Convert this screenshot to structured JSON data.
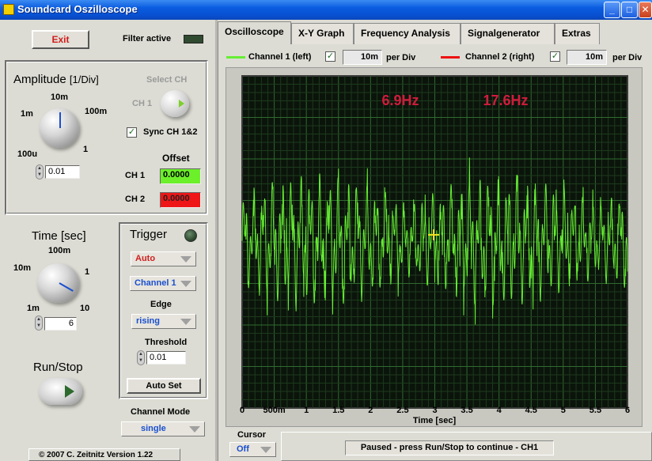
{
  "window": {
    "title": "Soundcard Oszilloscope",
    "minimize": "_",
    "maximize": "□",
    "close": "✕"
  },
  "left": {
    "exit_label": "Exit",
    "filter_label": "Filter active",
    "amplitude": {
      "title": "Amplitude",
      "unit": "[1/Div]",
      "scale": [
        "10m",
        "100m",
        "1m",
        "1",
        "100u"
      ],
      "value": "0.01"
    },
    "select_ch": {
      "title": "Select CH",
      "label": "CH 1"
    },
    "sync_label": "Sync CH 1&2",
    "offset": {
      "title": "Offset",
      "ch1_label": "CH 1",
      "ch1_value": "0.0000",
      "ch2_label": "CH 2",
      "ch2_value": "0.0000"
    },
    "time": {
      "title": "Time [sec]",
      "scale": [
        "100m",
        "10m",
        "1",
        "1m",
        "10"
      ],
      "value": "6"
    },
    "trigger": {
      "title": "Trigger",
      "mode": "Auto",
      "channel": "Channel 1",
      "edge_label": "Edge",
      "edge": "rising",
      "threshold_label": "Threshold",
      "threshold": "0.01",
      "autoset": "Auto Set"
    },
    "runstop_label": "Run/Stop",
    "channel_mode": {
      "label": "Channel Mode",
      "value": "single"
    },
    "copyright": "© 2007  C. Zeitnitz Version 1.22"
  },
  "tabs": [
    "Oscilloscope",
    "X-Y Graph",
    "Frequency Analysis",
    "Signalgenerator",
    "Extras"
  ],
  "channels": {
    "ch1": {
      "label": "Channel 1 (left)",
      "per_div": "10m",
      "per_div_label": "per Div",
      "color": "#66ee33"
    },
    "ch2": {
      "label": "Channel 2 (right)",
      "per_div": "10m",
      "per_div_label": "per Div",
      "color": "#ee1111"
    }
  },
  "scope": {
    "freq1": "6.9Hz",
    "freq2": "17.6Hz",
    "freq_color": "#d01c3c",
    "xlabel": "Time [sec]",
    "xticks": [
      "0",
      "500m",
      "1",
      "1.5",
      "2",
      "2.5",
      "3",
      "3.5",
      "4",
      "4.5",
      "5",
      "5.5",
      "6"
    ]
  },
  "cursor": {
    "label": "Cursor",
    "value": "Off"
  },
  "status": "Paused - press Run/Stop to continue - CH1"
}
